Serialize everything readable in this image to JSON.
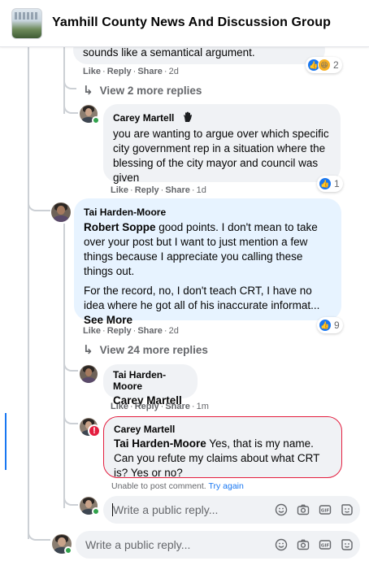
{
  "header": {
    "title": "Yamhill County News And Discussion Group"
  },
  "actions": {
    "like": "Like",
    "reply": "Reply",
    "share": "Share",
    "sep": "·"
  },
  "top_comment": {
    "text_tail": "sounds like a semantical argument.",
    "time": "2d",
    "reaction_count": "2"
  },
  "view_replies_1": {
    "label": "View 2 more replies"
  },
  "reply_1": {
    "author": "Carey Martell",
    "text": "you are wanting to argue over which specific city government rep in a situation where the blessing of the city mayor and council was given",
    "time": "1d",
    "reaction_count": "1"
  },
  "comment_2": {
    "author": "Tai Harden-Moore",
    "mention": "Robert Soppe",
    "para1_rest": " good points. I don't mean to take over your post but I want to just mention a few things because I appreciate you calling these things out.",
    "para2": "For the record, no, I don't teach CRT, I have no idea where he got all of his inaccurate informat...",
    "see_more": "See More",
    "time": "2d",
    "reaction_count": "9"
  },
  "view_replies_2": {
    "label": "View 24 more replies"
  },
  "reply_2": {
    "author": "Tai Harden-Moore",
    "mention": "Carey Martell",
    "time": "1m"
  },
  "reply_3": {
    "author": "Carey Martell",
    "mention": "Tai Harden-Moore",
    "text_rest": " Yes, that is my name. Can you refute my claims about what CRT is? Yes or no?",
    "status": "Unable to post comment.",
    "retry": "Try again"
  },
  "composer_reply": {
    "placeholder": "Write a public reply..."
  },
  "composer_main": {
    "placeholder": "Write a public reply..."
  },
  "icons": [
    "group-photo-icon",
    "emoji-icon",
    "camera-icon",
    "gif-icon",
    "sticker-icon",
    "like-reaction-icon",
    "haha-reaction-icon",
    "reply-arrow-icon",
    "error-icon",
    "hand-badge-icon"
  ],
  "colors": {
    "accent": "#1877f2",
    "error": "#e41e3f",
    "bubble": "#f0f2f5",
    "highlight": "#e7f3ff",
    "muted": "#65676b"
  }
}
